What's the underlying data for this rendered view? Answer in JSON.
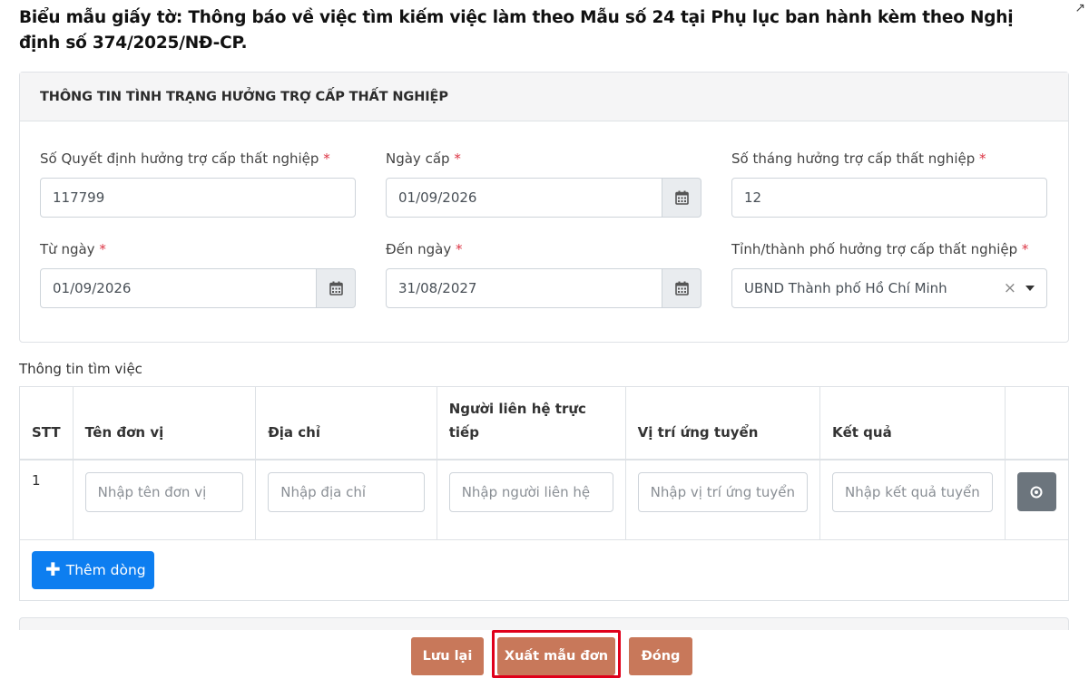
{
  "document_title": "Biểu mẫu giấy tờ: Thông báo về việc tìm kiếm việc làm theo Mẫu số 24 tại Phụ lục ban hành kèm theo Nghị định số 374/2025/NĐ-CP.",
  "unemployment_section": {
    "header": "THÔNG TIN TÌNH TRẠNG HƯỞNG TRỢ CẤP THẤT NGHIỆP",
    "required_mark": "*",
    "fields": {
      "decision_number": {
        "label": "Số Quyết định hưởng trợ cấp thất nghiệp",
        "value": "117799"
      },
      "issue_date": {
        "label": "Ngày cấp",
        "value": "01/09/2026"
      },
      "months": {
        "label": "Số tháng hưởng trợ cấp thất nghiệp",
        "value": "12"
      },
      "from_date": {
        "label": "Từ ngày",
        "value": "01/09/2026"
      },
      "to_date": {
        "label": "Đến ngày",
        "value": "31/08/2027"
      },
      "province": {
        "label": "Tỉnh/thành phố hưởng trợ cấp thất nghiệp",
        "value": "UBND Thành phố Hồ Chí Minh",
        "clear": "×"
      }
    }
  },
  "job_search": {
    "label": "Thông tin tìm việc",
    "columns": [
      "STT",
      "Tên đơn vị",
      "Địa chỉ",
      "Người liên hệ trực tiếp",
      "Vị trí ứng tuyển",
      "Kết quả"
    ],
    "rows": [
      {
        "stt": "1",
        "placeholders": [
          "Nhập tên đơn vị",
          "Nhập địa chỉ",
          "Nhập người liên hệ",
          "Nhập vị trí ứng tuyển",
          "Nhập kết quả tuyển"
        ]
      }
    ],
    "add_row_label": "Thêm dòng",
    "add_row_icon": "plus-icon",
    "remove_icon": "remove-circle-icon",
    "add_button_color": "#0d7ef0"
  },
  "footer": {
    "save_label": "Lưu lại",
    "export_label": "Xuất mẫu đơn",
    "close_label": "Đóng",
    "button_color": "#c8785a",
    "highlight_color": "#e0001b"
  }
}
